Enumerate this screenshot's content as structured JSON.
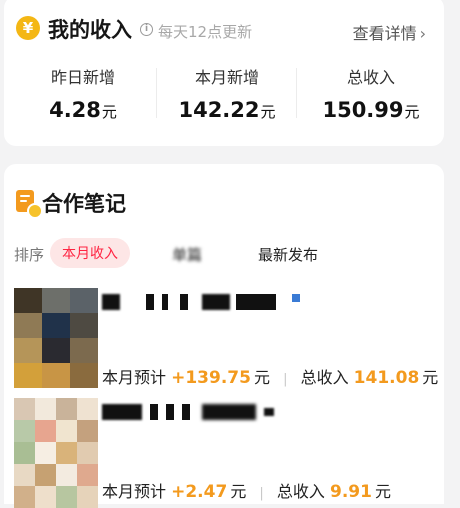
{
  "income": {
    "icon": "yen-coin-icon",
    "title": "我的收入",
    "refresh_note": "每天12点更新",
    "detail_link": "查看详情",
    "stats": [
      {
        "label": "昨日新增",
        "value": "4.28",
        "unit": "元"
      },
      {
        "label": "本月新增",
        "value": "142.22",
        "unit": "元"
      },
      {
        "label": "总收入",
        "value": "150.99",
        "unit": "元"
      }
    ]
  },
  "collab": {
    "icon": "note-badge-icon",
    "title": "合作笔记",
    "sort_label": "排序",
    "tabs": [
      "本月收入",
      "单篇",
      "最新发布"
    ],
    "active_tab": 0,
    "notes": [
      {
        "est_label": "本月预计",
        "est_value": "+139.75",
        "est_unit": "元",
        "total_label": "总收入",
        "total_value": "141.08",
        "total_unit": "元"
      },
      {
        "est_label": "本月预计",
        "est_value": "+2.47",
        "est_unit": "元",
        "total_label": "总收入",
        "total_value": "9.91",
        "total_unit": "元"
      }
    ]
  },
  "colors": {
    "accent_orange": "#f39a1e",
    "brand_red": "#ff2442",
    "yen_gold": "#f4b714"
  }
}
